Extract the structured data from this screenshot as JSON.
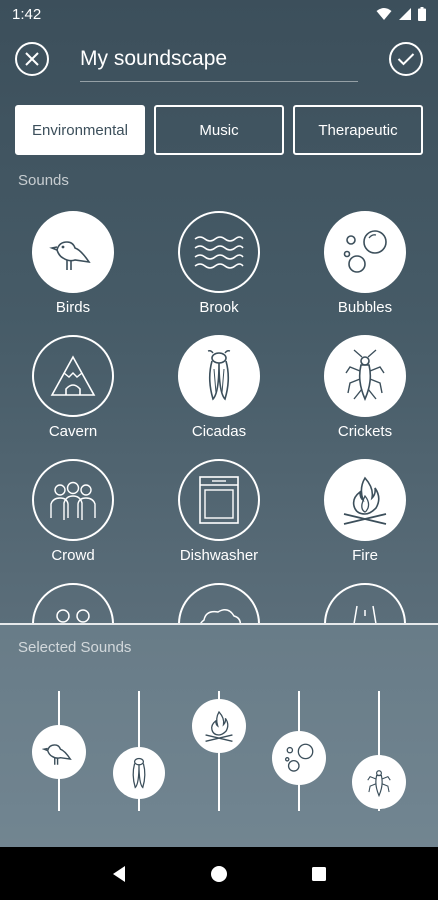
{
  "status_bar": {
    "time": "1:42"
  },
  "header": {
    "title": "My soundscape"
  },
  "tabs": [
    {
      "label": "Environmental",
      "active": true
    },
    {
      "label": "Music",
      "active": false
    },
    {
      "label": "Therapeutic",
      "active": false
    }
  ],
  "sounds_section": {
    "label": "Sounds"
  },
  "sounds": [
    {
      "label": "Birds",
      "icon": "bird-icon",
      "selected": true
    },
    {
      "label": "Brook",
      "icon": "waves-icon",
      "selected": false
    },
    {
      "label": "Bubbles",
      "icon": "bubbles-icon",
      "selected": true
    },
    {
      "label": "Cavern",
      "icon": "cavern-icon",
      "selected": false
    },
    {
      "label": "Cicadas",
      "icon": "cicada-icon",
      "selected": true
    },
    {
      "label": "Crickets",
      "icon": "cricket-icon",
      "selected": true
    },
    {
      "label": "Crowd",
      "icon": "crowd-icon",
      "selected": false
    },
    {
      "label": "Dishwasher",
      "icon": "dishwasher-icon",
      "selected": false
    },
    {
      "label": "Fire",
      "icon": "fire-icon",
      "selected": true
    }
  ],
  "selected_section": {
    "label": "Selected Sounds"
  },
  "selected_sounds": [
    {
      "name": "Birds",
      "icon": "bird-icon",
      "level": 0.55
    },
    {
      "name": "Cicadas",
      "icon": "cicada-icon",
      "level": 0.3
    },
    {
      "name": "Fire",
      "icon": "fire-icon",
      "level": 0.75
    },
    {
      "name": "Bubbles",
      "icon": "bubbles-icon",
      "level": 0.45
    },
    {
      "name": "Crickets",
      "icon": "cricket-icon",
      "level": 0.2
    }
  ],
  "colors": {
    "accent": "#3c4f5b",
    "background_top": "#3c4f5b",
    "background_bottom": "#6b7e8a"
  }
}
